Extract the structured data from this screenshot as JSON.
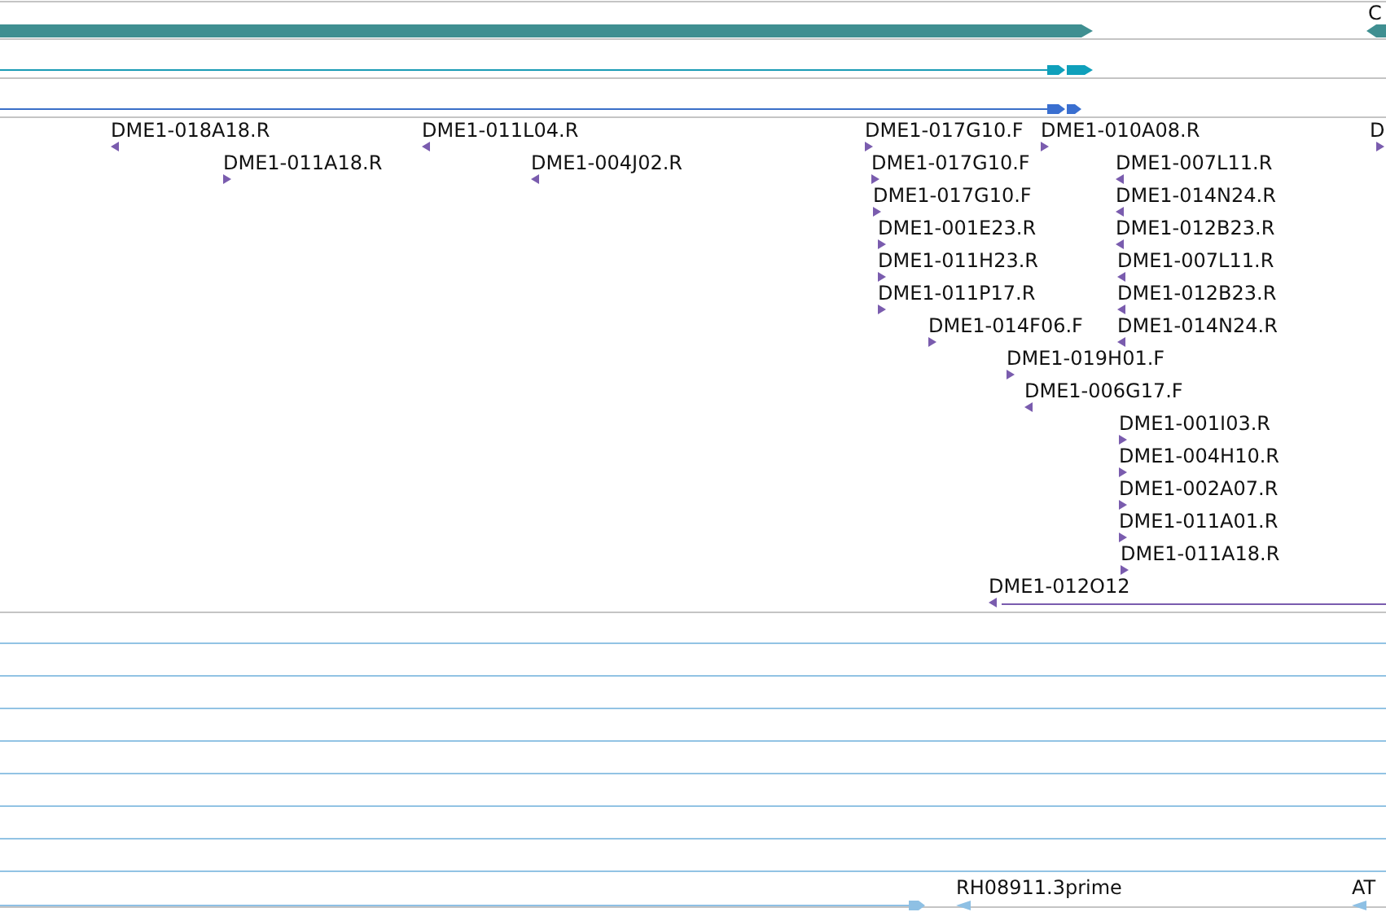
{
  "gene_track": {
    "label": "C",
    "reverse": true
  },
  "features": [
    {
      "label": "DME1-018A18.R",
      "reverse": true
    },
    {
      "label": "DME1-011L04.R",
      "reverse": true
    },
    {
      "label": "DME1-017G10.F",
      "reverse": false
    },
    {
      "label": "DME1-010A08.R",
      "reverse": false
    },
    {
      "label": "D",
      "reverse": false
    },
    {
      "label": "DME1-011A18.R",
      "reverse": false
    },
    {
      "label": "DME1-004J02.R",
      "reverse": true
    },
    {
      "label": "DME1-017G10.F",
      "reverse": false
    },
    {
      "label": "DME1-007L11.R",
      "reverse": true
    },
    {
      "label": "DME1-017G10.F",
      "reverse": false
    },
    {
      "label": "DME1-014N24.R",
      "reverse": true
    },
    {
      "label": "DME1-001E23.R",
      "reverse": false
    },
    {
      "label": "DME1-012B23.R",
      "reverse": true
    },
    {
      "label": "DME1-011H23.R",
      "reverse": false
    },
    {
      "label": "DME1-007L11.R",
      "reverse": true
    },
    {
      "label": "DME1-011P17.R",
      "reverse": false
    },
    {
      "label": "DME1-012B23.R",
      "reverse": true
    },
    {
      "label": "DME1-014F06.F",
      "reverse": false
    },
    {
      "label": "DME1-014N24.R",
      "reverse": true
    },
    {
      "label": "DME1-019H01.F",
      "reverse": false
    },
    {
      "label": "DME1-006G17.F",
      "reverse": true
    },
    {
      "label": "DME1-001I03.R",
      "reverse": false
    },
    {
      "label": "DME1-004H10.R",
      "reverse": false
    },
    {
      "label": "DME1-002A07.R",
      "reverse": false
    },
    {
      "label": "DME1-011A01.R",
      "reverse": false
    },
    {
      "label": "DME1-011A18.R",
      "reverse": false
    },
    {
      "label": "DME1-012O12",
      "reverse": true
    }
  ],
  "bottom_features": [
    {
      "label": "RH08911.3prime",
      "reverse": true
    },
    {
      "label": "AT",
      "reverse": true
    }
  ]
}
